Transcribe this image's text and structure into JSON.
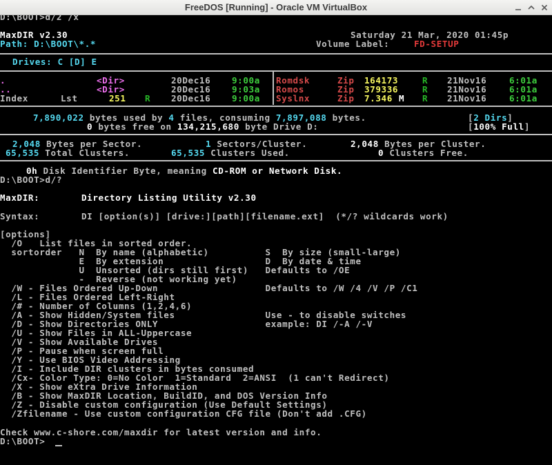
{
  "window": {
    "title": "FreeDOS [Running] - Oracle VM VirtualBox"
  },
  "console": {
    "cmd1": "D:\\BOOT>d/2 /x",
    "app_name": "MaxDIR v2.30",
    "date": "Saturday 21 Mar, 2020 01:45p",
    "path_label": "Path: D:\\BOOT\\*.*",
    "volume_label_label": "Volume Label: ",
    "volume_label": "FD-SETUP",
    "drives": "Drives: C [D] E",
    "left_files": [
      {
        "name": ".",
        "size": "<Dir>",
        "date": "20Dec16",
        "time": "9:00a"
      },
      {
        "name": "..",
        "size": "<Dir>",
        "date": "20Dec16",
        "time": "9:03a"
      },
      {
        "name": "Index",
        "ext": "Lst",
        "size": "251",
        "attr": "R",
        "date": "20Dec16",
        "time": "9:00a"
      }
    ],
    "right_files": [
      {
        "name": "Romdsk",
        "ext": "Zip",
        "size": "164173",
        "attr": "R",
        "date": "21Nov16",
        "time": "6:01a"
      },
      {
        "name": "Romos",
        "ext": "Zip",
        "size": "379336",
        "attr": "R",
        "date": "21Nov16",
        "time": "6:01a"
      },
      {
        "name": "Syslnx",
        "ext": "Zip",
        "size": "7.346",
        "unit": "M",
        "attr": "R",
        "date": "21Nov16",
        "time": "6:01a"
      }
    ],
    "summary": {
      "bytes_used": "7,890,022",
      "files_count": "4",
      "consuming": "7,897,088",
      "dirs": "2 Dirs",
      "bytes_free": "0",
      "drive_size": "134,215,680",
      "full": "100% Full",
      "t_used_a": " bytes used by ",
      "t_used_b": " files, consuming ",
      "t_used_c": " bytes.",
      "t_free_a": " bytes free on ",
      "t_free_b": " byte Drive D:"
    },
    "cluster": {
      "bps": "2,048",
      "t_bps": " Bytes per Sector.",
      "spc": "1",
      "t_spc": " Sectors/Cluster.",
      "bpc": "2,048",
      "t_bpc": " Bytes per Cluster.",
      "total": "65,535",
      "t_total": " Total Clusters.",
      "used": "65,535",
      "t_used": " Clusters Used.",
      "free": "0",
      "t_free": " Clusters Free."
    },
    "disk_id": "0h",
    "disk_id_text_a": " Disk Identifier Byte, meaning ",
    "disk_id_text_b": "CD-ROM or Network Disk.",
    "cmd2": "D:\\BOOT>d/?",
    "help_title_left": "MaxDIR:",
    "help_title_right": "Directory Listing Utility v2.30",
    "syntax_left": "Syntax:",
    "syntax_right": "DI [option(s)] [drive:][path][filename.ext]  (*/? wildcards work)",
    "options_lines": [
      "[options]",
      "  /O   List files in sorted order.",
      "  sortorder   N  By name (alphabetic)          S  By size (small-large)",
      "              E  By extension                  D  By date & time",
      "              U  Unsorted (dirs still first)   Defaults to /OE",
      "              -  Reverse (not working yet)",
      "  /W - Files Ordered Up-Down                   Defaults to /W /4 /V /P /C1",
      "  /L - Files Ordered Left-Right",
      "  /# - Number of Columns (1,2,4,6)",
      "  /A - Show Hidden/System files                Use - to disable switches",
      "  /D - Show Directories ONLY                   example: DI /-A /-V",
      "  /U - Show Files in ALL-Uppercase",
      "  /V - Show Available Drives",
      "  /P - Pause when screen full",
      "  /Y - Use BIOS Video Addressing",
      "  /I - Include DIR clusters in bytes consumed",
      "  /Cx- Color Type: 0=No Color  1=Standard  2=ANSI  (1 can't Redirect)",
      "  /X - Show eXtra Drive Information",
      "  /B - Show MaxDIR Location, BuildID, and DOS Version Info",
      "  /Z - Disable custom configuration (Use Default Settings)",
      "  /Zfilename - Use custom configuration CFG file (Don't add .CFG)"
    ],
    "check_line": "Check www.c-shore.com/maxdir for latest version and info.",
    "prompt": "D:\\BOOT>"
  },
  "colors": {
    "background": "#000000",
    "text": "#c0c0c0",
    "highlight": "#ffffff",
    "accent": "#55d9f0",
    "number": "#f8f860",
    "dir": "#f070f0",
    "volume": "#e43a3a"
  }
}
